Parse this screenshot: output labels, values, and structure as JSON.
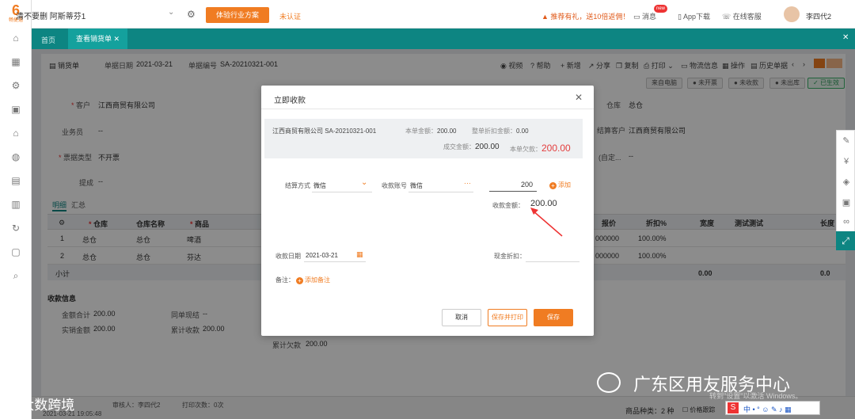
{
  "app": {
    "logo_text": "6",
    "logo_sub": "畅捷通",
    "company": "清不要删 阿斯蒂芬1",
    "trial_button": "体验行业方案",
    "unverified": "未认证",
    "promo": "推荐有礼，送10倍返佣！",
    "messages": "消息",
    "badge": "new",
    "app_download": "App下载",
    "online_service": "在线客服",
    "user": "李四代2"
  },
  "tabs": {
    "home": "首页",
    "active": "查看销货单"
  },
  "header": {
    "doc_type": "销货单",
    "date_label": "单据日期",
    "date": "2021-03-21",
    "no_label": "单据编号",
    "no": "SA-20210321-001",
    "tools": [
      "视频",
      "帮助",
      "新增",
      "分享",
      "复制",
      "打印",
      "物流信息",
      "操作",
      "历史单据"
    ],
    "statuses": [
      "来自电脑",
      "未开票",
      "未收款",
      "未出库",
      "已生效"
    ]
  },
  "form": {
    "customer_label": "客户",
    "customer": "江西商贸有限公司",
    "salesman_label": "业务员",
    "salesman": "--",
    "invoice_type_label": "票据类型",
    "invoice_type": "不开票",
    "remind_label": "提成",
    "remind": "--",
    "warehouse_label": "仓库",
    "warehouse": "总仓",
    "settle_customer_label": "结算客户",
    "settle_customer": "江西商贸有限公司",
    "custom_label": "(自定...",
    "custom": "--"
  },
  "detail_tabs": [
    "明细",
    "汇总"
  ],
  "grid": {
    "headers": [
      "仓库",
      "仓库名称",
      "商品",
      "报价",
      "折扣%",
      "宽度",
      "测试测试",
      "长度"
    ],
    "rows": [
      {
        "no": "1",
        "warehouse": "总仓",
        "wh_name": "总仓",
        "product": "啤酒",
        "price": "000000",
        "discount": "100.00%"
      },
      {
        "no": "2",
        "warehouse": "总仓",
        "wh_name": "总仓",
        "product": "芬达",
        "price": "000000",
        "discount": "100.00%"
      }
    ],
    "subtotal_label": "小计",
    "subtotal_width": "0.00",
    "subtotal_length": "0.0"
  },
  "receipt": {
    "section_title": "收款信息",
    "total_label": "金额合计",
    "total": "200.00",
    "same_label": "同单现结",
    "same": "--",
    "actual_label": "实销金额",
    "actual": "200.00",
    "cumulative_label": "累计收款",
    "cumulative": "200.00",
    "owed_label": "累计欠款",
    "owed": "200.00"
  },
  "modal": {
    "title": "立即收款",
    "info": {
      "customer_doc": "江西商贸有限公司 SA-20210321-001",
      "amount_label": "本单金额：",
      "amount": "200.00",
      "discount_label": "整单折扣金额：",
      "discount": "0.00",
      "deal_label": "成交金额：",
      "deal": "200.00",
      "owe_label": "本单欠款：",
      "owe": "200.00"
    },
    "settle_method_label": "结算方式",
    "settle_method": "微信",
    "account_label": "收款账号",
    "account": "微信",
    "amount_input": "200",
    "add_label": "添加",
    "received_label": "收款金额：",
    "received": "200.00",
    "date_label": "收款日期",
    "date": "2021-03-21",
    "cash_discount_label": "现金折扣：",
    "note_label": "备注：",
    "add_note": "添加备注",
    "buttons": {
      "cancel": "取消",
      "save_print": "保存并打印",
      "save": "保存"
    }
  },
  "footer": {
    "reviewer_label": "审核人：",
    "reviewer": "李四代2",
    "print_label": "打印次数：",
    "print_count": "0次",
    "timestamp": "2021-03-21 19:05:48",
    "product_kinds_label": "商品种类：",
    "product_kinds": "2 种",
    "price_tracking": "价格跟踪"
  },
  "watermarks": {
    "wechat": "广东区用友服务中心",
    "windows": "转到\"设置\"以激活 Windows。",
    "brand": "大数跨境"
  },
  "colors": {
    "accent": "#f07c22",
    "teal": "#0d8582",
    "danger": "#e33e3e"
  }
}
